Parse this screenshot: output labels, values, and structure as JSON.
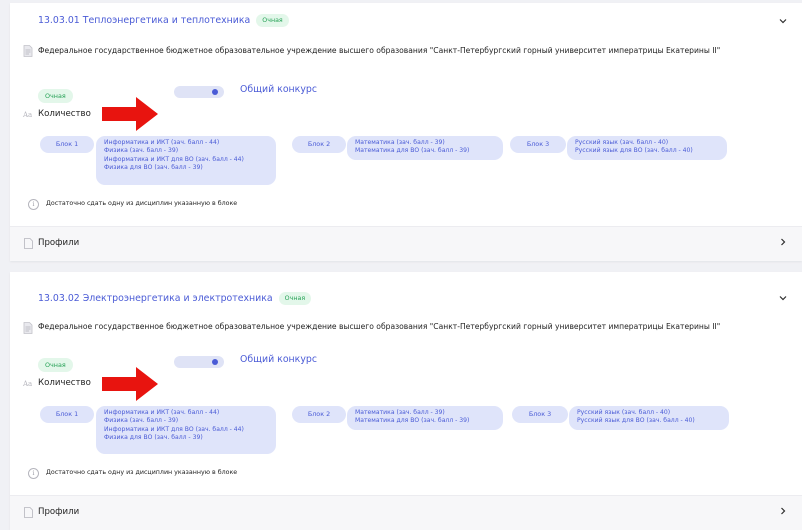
{
  "programs": [
    {
      "title": "13.03.01 Теплоэнергетика и теплотехника",
      "form_badge": "Очная",
      "institution": "Федеральное государственное бюджетное образовательное учреждение высшего образования \"Санкт-Петербургский горный университет императрицы Екатерины II\"",
      "form": "Очная",
      "contest_label": "Общий конкурс",
      "quantity_label": "Количество",
      "blocks": [
        {
          "label": "Блок 1",
          "subjects": [
            "Информатика и ИКТ (зач. балл - 44)",
            "Физика (зач. балл - 39)",
            "Информатика и ИКТ для ВО (зач. балл - 44)",
            "Физика для ВО (зач. балл - 39)"
          ]
        },
        {
          "label": "Блок 2",
          "subjects": [
            "Математика (зач. балл - 39)",
            "Математика для ВО (зач. балл - 39)"
          ]
        },
        {
          "label": "Блок 3",
          "subjects": [
            "Русский язык (зач. балл - 40)",
            "Русский язык для ВО (зач. балл - 40)"
          ]
        }
      ],
      "note": "Достаточно сдать одну из дисциплин указанную в блоке",
      "profiles_label": "Профили"
    },
    {
      "title": "13.03.02 Электроэнергетика и электротехника",
      "form_badge": "Очная",
      "institution": "Федеральное государственное бюджетное образовательное учреждение высшего образования \"Санкт-Петербургский горный университет императрицы Екатерины II\"",
      "form": "Очная",
      "contest_label": "Общий конкурс",
      "quantity_label": "Количество",
      "blocks": [
        {
          "label": "Блок 1",
          "subjects": [
            "Информатика и ИКТ (зач. балл - 44)",
            "Физика (зач. балл - 39)",
            "Информатика и ИКТ для ВО (зач. балл - 44)",
            "Физика для ВО (зач. балл - 39)"
          ]
        },
        {
          "label": "Блок 2",
          "subjects": [
            "Математика (зач. балл - 39)",
            "Математика для ВО (зач. балл - 39)"
          ]
        },
        {
          "label": "Блок 3",
          "subjects": [
            "Русский язык (зач. балл - 40)",
            "Русский язык для ВО (зач. балл - 40)"
          ]
        }
      ],
      "note": "Достаточно сдать одну из дисциплин указанную в блоке",
      "profiles_label": "Профили"
    }
  ],
  "icons": {
    "expand": "chevron-down-icon",
    "document": "document-icon",
    "quantity": "text-size-icon",
    "info": "info-icon",
    "profiles": "file-icon",
    "profiles_open": "chevron-right-icon",
    "annotation": "red-arrow-icon"
  },
  "colors": {
    "accent": "#4a5bd6",
    "badge_bg": "#e3f7ea",
    "badge_text": "#27a257",
    "pill_bg": "#dfe4fa",
    "arrow": "#e8140f"
  }
}
